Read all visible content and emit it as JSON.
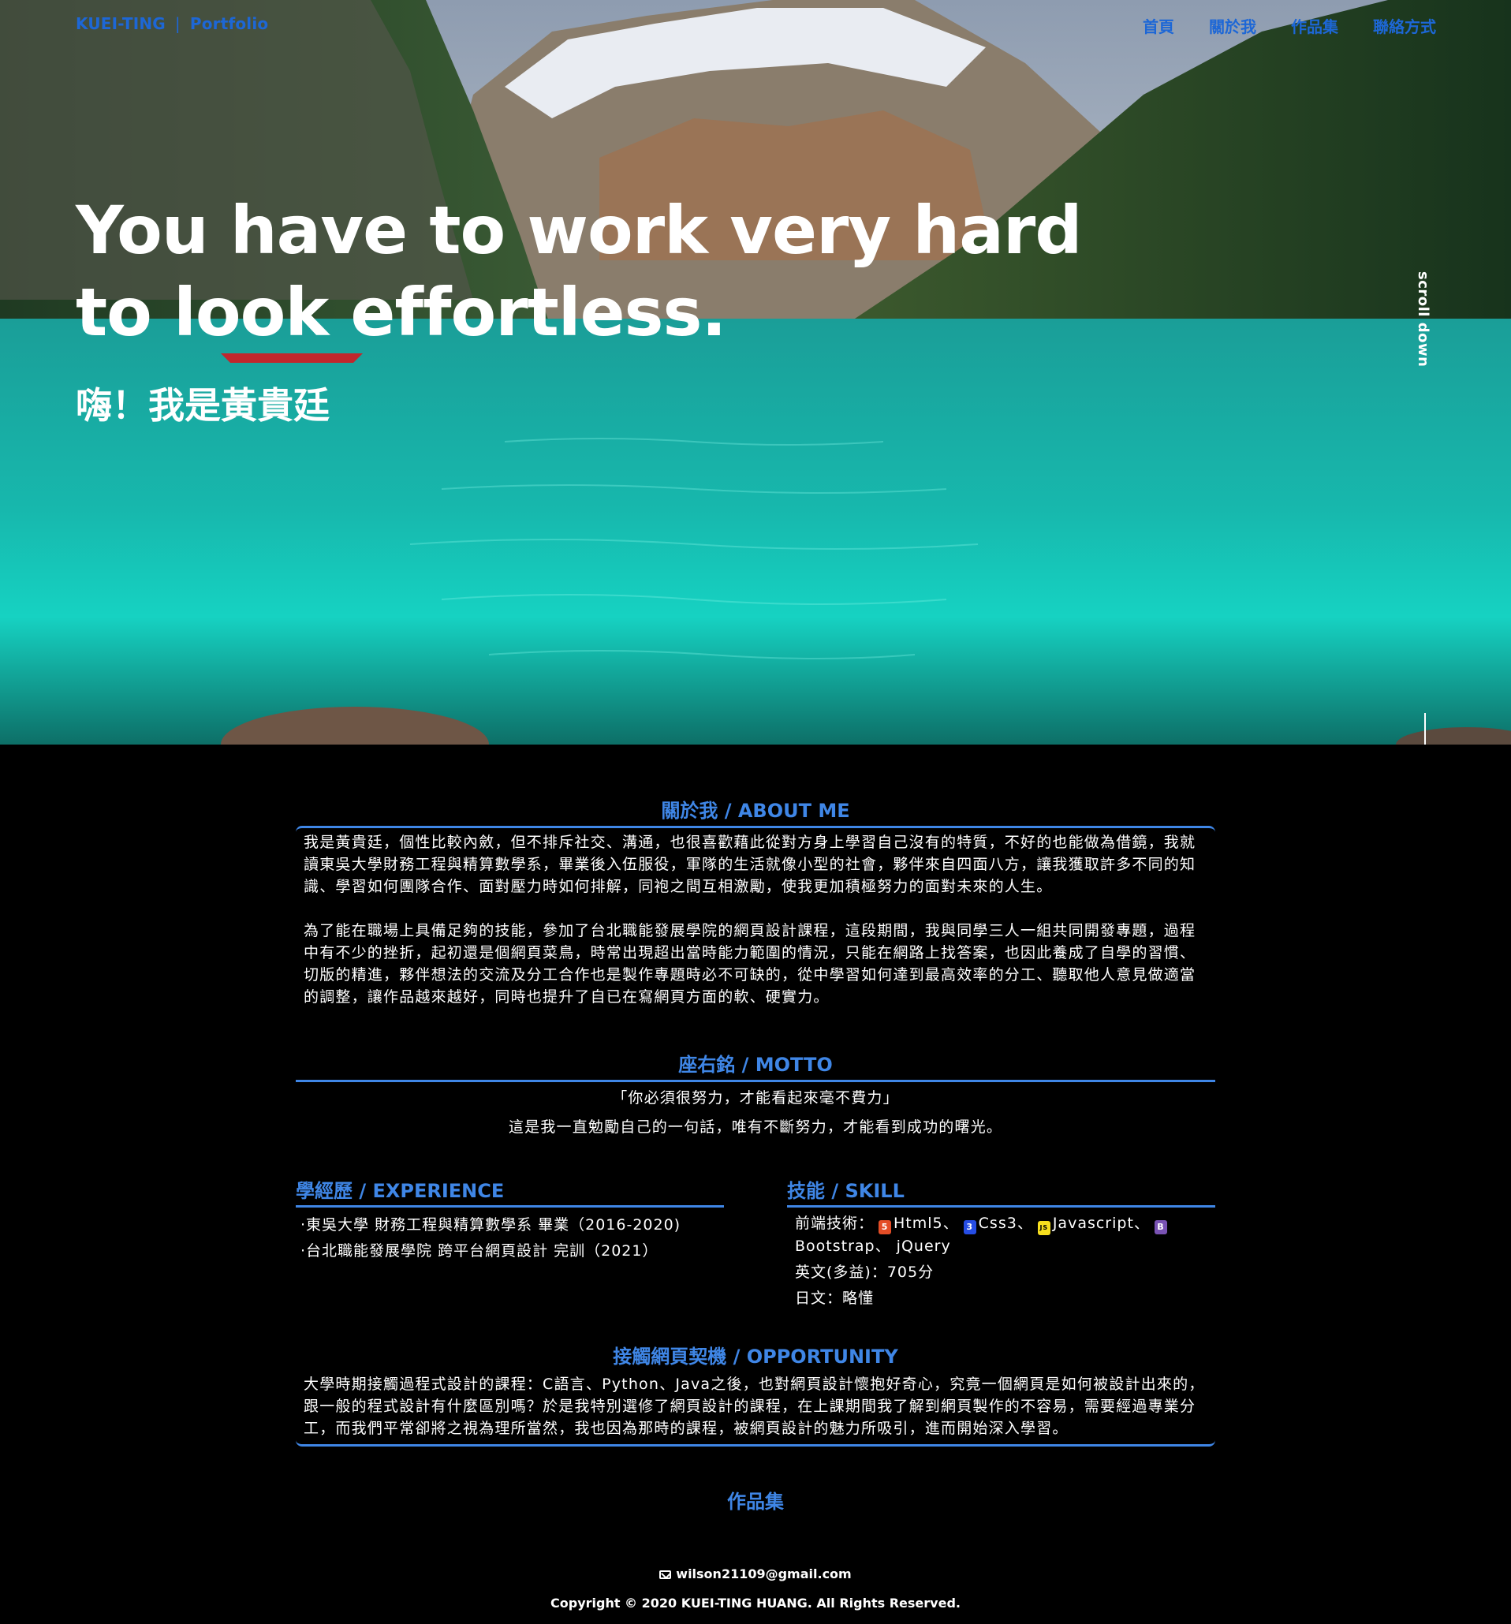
{
  "brand": {
    "name": "KUEI-TING",
    "separator": "|",
    "suffix": "Portfolio"
  },
  "nav": {
    "items": [
      {
        "label": "首頁"
      },
      {
        "label": "關於我"
      },
      {
        "label": "作品集"
      },
      {
        "label": "聯絡方式"
      }
    ]
  },
  "hero": {
    "headline": "You have to work very hard to look effortless.",
    "greeting": "嗨！我是黃貴廷",
    "scroll_label": "scroll down"
  },
  "about": {
    "title": "關於我 / ABOUT ME",
    "paragraphs": [
      "我是黃貴廷，個性比較內斂，但不排斥社交、溝通，也很喜歡藉此從對方身上學習自己沒有的特質，不好的也能做為借鏡，我就讀東吳大學財務工程與精算數學系，畢業後入伍服役，軍隊的生活就像小型的社會，夥伴來自四面八方，讓我獲取許多不同的知識、學習如何團隊合作、面對壓力時如何排解，同袍之間互相激勵，使我更加積極努力的面對未來的人生。",
      "為了能在職場上具備足夠的技能，參加了台北職能發展學院的網頁設計課程，這段期間，我與同學三人一組共同開發專題，過程中有不少的挫折，起初還是個網頁菜鳥，時常出現超出當時能力範圍的情況，只能在網路上找答案，也因此養成了自學的習慣、切版的精進，夥伴想法的交流及分工合作也是製作專題時必不可缺的，從中學習如何達到最高效率的分工、聽取他人意見做適當的調整，讓作品越來越好，同時也提升了自已在寫網頁方面的軟、硬實力。"
    ]
  },
  "motto": {
    "title": "座右銘 / MOTTO",
    "quote": "「你必須很努力，才能看起來毫不費力」",
    "note": "這是我一直勉勵自己的一句話，唯有不斷努力，才能看到成功的曙光。"
  },
  "experience": {
    "title": "學經歷 / EXPERIENCE",
    "items": [
      "‧東吳大學 財務工程與精算數學系 畢業（2016-2020)",
      "‧台北職能發展學院 跨平台網頁設計 完訓（2021）"
    ]
  },
  "skill": {
    "title": "技能 / SKILL",
    "frontend_label": "前端技術：",
    "tech": {
      "html": "Html5",
      "css": "Css3",
      "js": "Javascript",
      "bootstrap": "Bootstrap",
      "jquery": "jQuery",
      "sep": "、"
    },
    "icons": {
      "html": "html5-icon",
      "css": "css3-icon",
      "js": "javascript-icon",
      "bootstrap": "bootstrap-icon"
    },
    "english": "英文(多益)：705分",
    "japanese": "日文：略懂"
  },
  "opportunity": {
    "title": "接觸網頁契機 / OPPORTUNITY",
    "text": "大學時期接觸過程式設計的課程：C語言、Python、Java之後，也對網頁設計懷抱好奇心，究竟一個網頁是如何被設計出來的，跟一般的程式設計有什麼區別嗎？於是我特別選修了網頁設計的課程，在上課期間我了解到網頁製作的不容易，需要經過專業分工，而我們平常卻將之視為理所當然，我也因為那時的課程，被網頁設計的魅力所吸引，進而開始深入學習。"
  },
  "works": {
    "title": "作品集"
  },
  "footer": {
    "email": "wilson21109@gmail.com",
    "copyright": "Copyright © 2020 KUEI-TING HUANG. All Rights Reserved."
  },
  "colors": {
    "accent": "#3f86e6",
    "nav": "#1d67d6",
    "background": "#000000"
  }
}
